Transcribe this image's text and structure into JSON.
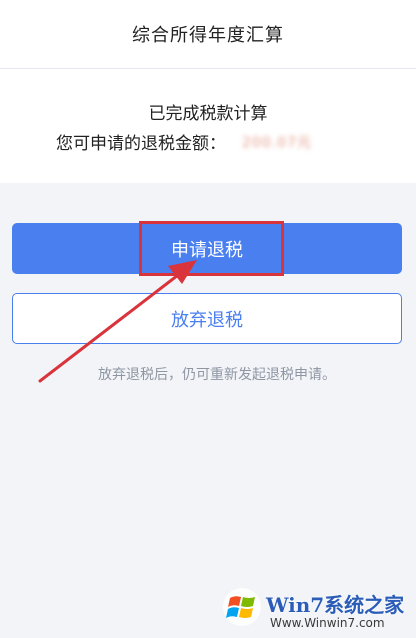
{
  "header": {
    "title": "综合所得年度汇算"
  },
  "status": {
    "line1": "已完成税款计算",
    "line2_label": "您可申请的退税金额：",
    "amount_blurred": "200.07元"
  },
  "actions": {
    "apply_label": "申请退税",
    "abandon_label": "放弃退税"
  },
  "hint": "放弃退税后，仍可重新发起退税申请。",
  "annotation_colors": {
    "highlight": "#d9333b",
    "primary": "#4a7ff0"
  },
  "watermark": {
    "brand": "Win7系统之家",
    "url": "Www.Winwin7.com"
  }
}
